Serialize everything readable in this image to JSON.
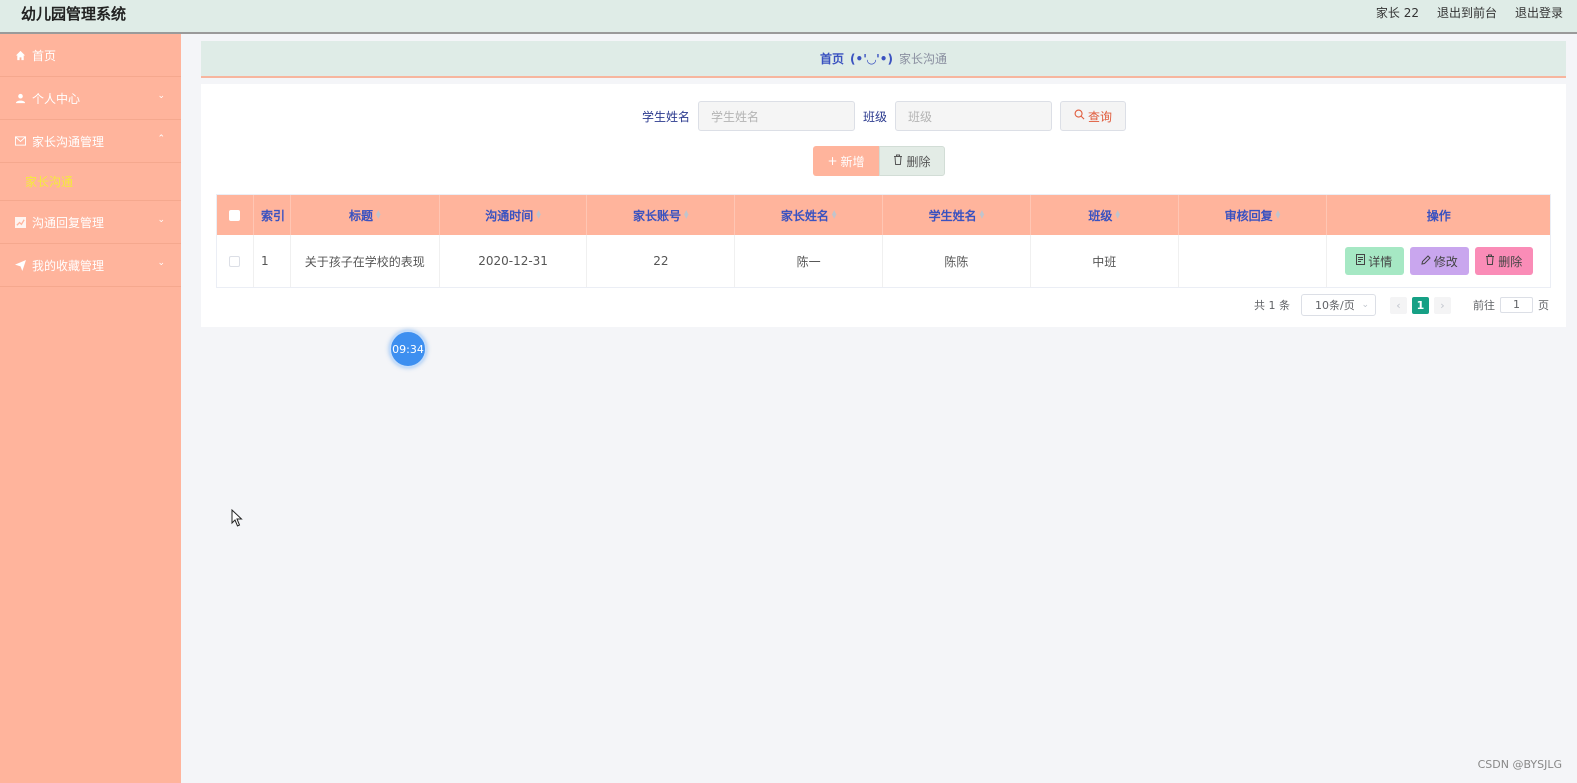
{
  "header": {
    "brand": "幼儿园管理系统",
    "user": "家长 22",
    "to_front": "退出到前台",
    "logout": "退出登录"
  },
  "sidebar": {
    "items": [
      {
        "label": "首页",
        "icon": "home-icon"
      },
      {
        "label": "个人中心",
        "icon": "user-icon"
      },
      {
        "label": "家长沟通管理",
        "icon": "mail-icon"
      },
      {
        "label": "沟通回复管理",
        "icon": "chart-icon"
      },
      {
        "label": "我的收藏管理",
        "icon": "send-icon"
      }
    ],
    "sub_item": "家长沟通"
  },
  "breadcrumb": {
    "home": "首页",
    "sep": "(•'◡'•)",
    "current": "家长沟通"
  },
  "search": {
    "student_label": "学生姓名",
    "student_placeholder": "学生姓名",
    "class_label": "班级",
    "class_placeholder": "班级",
    "query_label": "查询"
  },
  "actions": {
    "add_label": "新增",
    "delete_label": "删除"
  },
  "table": {
    "headers": [
      "索引",
      "标题",
      "沟通时间",
      "家长账号",
      "家长姓名",
      "学生姓名",
      "班级",
      "审核回复",
      "操作"
    ],
    "rows": [
      {
        "index": "1",
        "title": "关于孩子在学校的表现",
        "time": "2020-12-31",
        "account": "22",
        "parent": "陈一",
        "student": "陈陈",
        "class": "中班",
        "reply": ""
      }
    ],
    "ops": {
      "detail": "详情",
      "edit": "修改",
      "remove": "删除"
    }
  },
  "pager": {
    "total": "共 1 条",
    "page_size": "10条/页",
    "current_page": "1",
    "goto_label": "前往",
    "goto_value": "1",
    "page_suffix": "页"
  },
  "timer": "09:34",
  "watermark": "CSDN @BYSJLG",
  "colors": {
    "accent": "#ffb49c",
    "header_bg": "#dfece7",
    "link_blue": "#3a52c0",
    "active_sub": "#f5ea3c",
    "page_active": "#16a085"
  }
}
